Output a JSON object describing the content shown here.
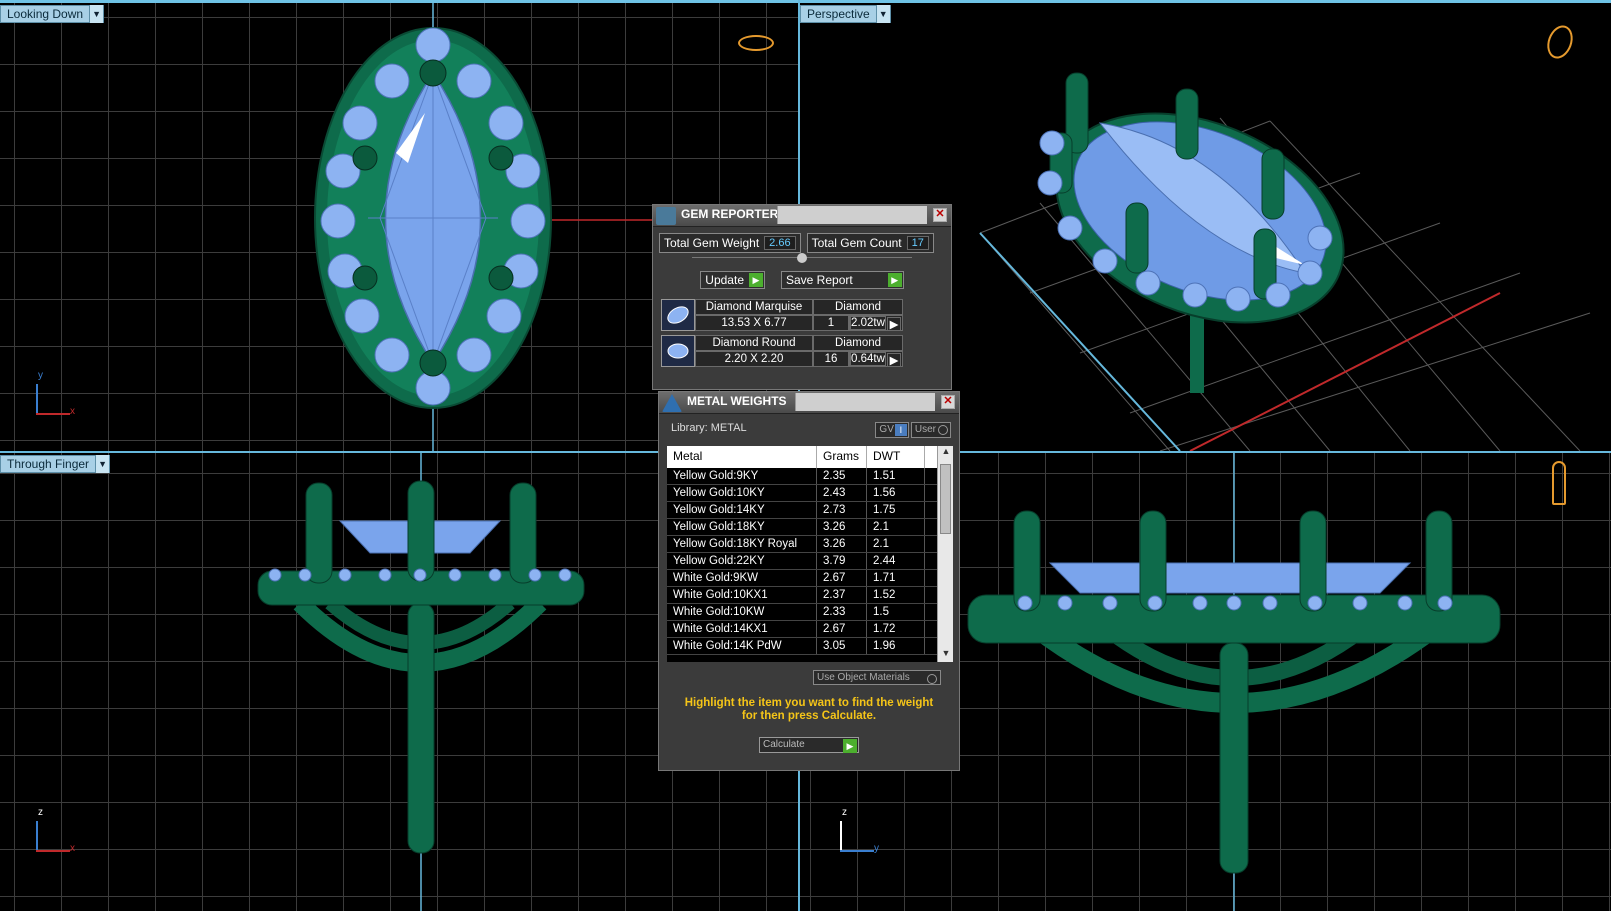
{
  "viewports": {
    "top_left": {
      "label": "Looking Down",
      "axis_v": "y",
      "axis_h": "x"
    },
    "top_right": {
      "label": "Perspective"
    },
    "bottom_left": {
      "label": "Through Finger",
      "axis_v": "z",
      "axis_h": "x"
    },
    "bottom_right": {
      "axis_v": "z",
      "axis_h": "y"
    }
  },
  "gem_reporter": {
    "title": "GEM REPORTER",
    "total_weight_label": "Total Gem Weight",
    "total_weight_value": "2.66",
    "total_count_label": "Total Gem Count",
    "total_count_value": "17",
    "update_label": "Update",
    "save_label": "Save Report",
    "gems": [
      {
        "name": "Diamond Marquise",
        "material": "Diamond",
        "size": "13.53 X 6.77",
        "count": "1",
        "weight": "2.02tw"
      },
      {
        "name": "Diamond Round",
        "material": "Diamond",
        "size": "2.20 X 2.20",
        "count": "16",
        "weight": "0.64tw"
      }
    ]
  },
  "metal_weights": {
    "title": "METAL WEIGHTS",
    "library_label": "Library: METAL",
    "toggle_gv": "GV",
    "toggle_user": "User",
    "columns": [
      "Metal",
      "Grams",
      "DWT"
    ],
    "rows": [
      [
        "Yellow Gold:9KY",
        "2.35",
        "1.51"
      ],
      [
        "Yellow Gold:10KY",
        "2.43",
        "1.56"
      ],
      [
        "Yellow Gold:14KY",
        "2.73",
        "1.75"
      ],
      [
        "Yellow Gold:18KY",
        "3.26",
        "2.1"
      ],
      [
        "Yellow Gold:18KY Royal",
        "3.26",
        "2.1"
      ],
      [
        "Yellow Gold:22KY",
        "3.79",
        "2.44"
      ],
      [
        "White Gold:9KW",
        "2.67",
        "1.71"
      ],
      [
        "White Gold:10KX1",
        "2.37",
        "1.52"
      ],
      [
        "White Gold:10KW",
        "2.33",
        "1.5"
      ],
      [
        "White Gold:14KX1",
        "2.67",
        "1.72"
      ],
      [
        "White Gold:14K PdW",
        "3.05",
        "1.96"
      ]
    ],
    "use_object_materials": "Use Object Materials",
    "hint_line1": "Highlight the item you want to find the weight",
    "hint_line2": "for then press Calculate.",
    "calculate_label": "Calculate"
  },
  "colors": {
    "metal": "#0e6b4b",
    "gem": "#7fa9ee",
    "ui_accent": "#66b8dc",
    "hint": "#f5c518"
  }
}
